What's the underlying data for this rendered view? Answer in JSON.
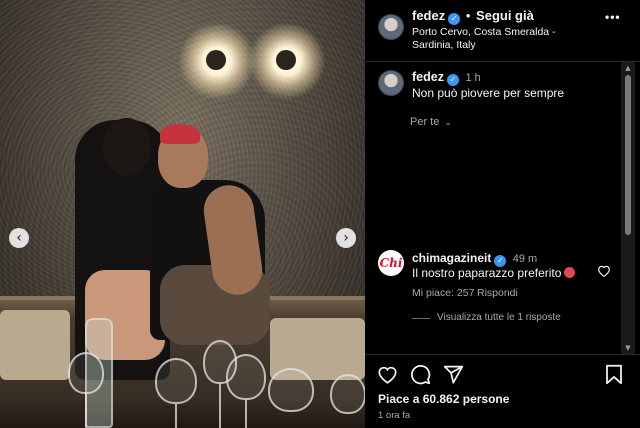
{
  "post": {
    "username": "fedez",
    "follow_state": "Segui già",
    "location": "Porto Cervo, Costa Smeralda - Sardinia, Italy",
    "more_label": "•••"
  },
  "caption": {
    "username": "fedez",
    "time": "1 h",
    "text": "Non può piovere per sempre",
    "translation_label": "Per te"
  },
  "comment": {
    "username": "chimagazineit",
    "avatar_text": "Chi",
    "time": "49 m",
    "text": "Il nostro paparazzo preferito",
    "likes": "Mi piace: 257",
    "reply_label": "Rispondi",
    "view_replies": "Visualizza tutte le 1 risposte"
  },
  "footer": {
    "likes": "Piace a 60.862 persone",
    "time": "1 ora fa"
  },
  "carousel": {
    "prev": "‹",
    "next": "›"
  },
  "icons": [
    "heart-icon",
    "comment-icon",
    "share-icon",
    "bookmark-icon",
    "verified-icon",
    "chevron-down-icon",
    "comment-like-icon"
  ],
  "colors": {
    "verified": "#3897f0",
    "chi_brand": "#d4142a",
    "muted": "#a8a8a8"
  }
}
